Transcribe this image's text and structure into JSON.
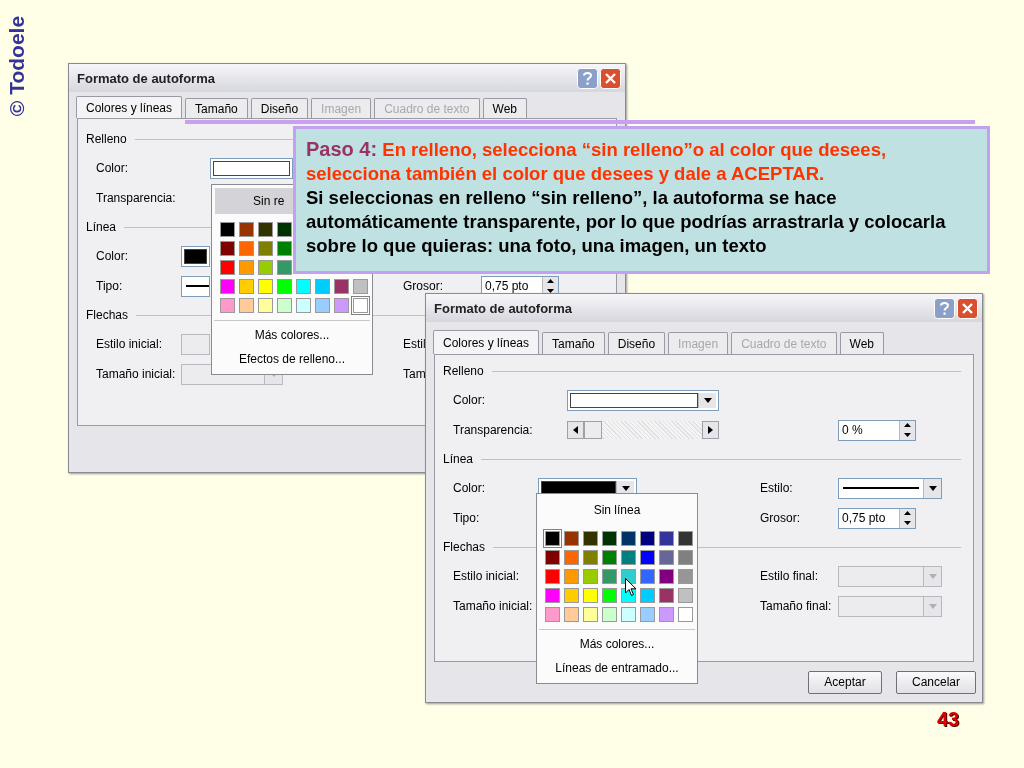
{
  "logo": "© Todoele",
  "dialogs": [
    {
      "title": "Formato de autoforma",
      "tabs": [
        {
          "label": "Colores y líneas",
          "selected": true,
          "disabled": false
        },
        {
          "label": "Tamaño",
          "selected": false,
          "disabled": false
        },
        {
          "label": "Diseño",
          "selected": false,
          "disabled": false
        },
        {
          "label": "Imagen",
          "selected": false,
          "disabled": true
        },
        {
          "label": "Cuadro de texto",
          "selected": false,
          "disabled": true
        },
        {
          "label": "Web",
          "selected": false,
          "disabled": false
        }
      ],
      "sections": [
        {
          "title": "Relleno",
          "rows": [
            {
              "label": "Color:",
              "field": {
                "kind": "color",
                "color": "#ffffff"
              }
            },
            {
              "label": "Transparencia:"
            }
          ]
        },
        {
          "title": "Línea",
          "rows": [
            {
              "label": "Color:",
              "field": {
                "kind": "color",
                "color": "#000000"
              }
            },
            {
              "label": "Tipo:",
              "field": {
                "kind": "line"
              },
              "right": {
                "label": "Grosor:",
                "field": {
                  "kind": "spinner",
                  "value": "0,75 pto"
                }
              }
            }
          ]
        },
        {
          "title": "Flechas",
          "rows": [
            {
              "label": "Estilo inicial:",
              "field": {
                "kind": "dropdown",
                "disabled": true
              },
              "right": {
                "label": "Estil"
              }
            },
            {
              "label": "Tamaño inicial:",
              "field": {
                "kind": "dropdown",
                "disabled": true
              },
              "right": {
                "label": "Tam"
              }
            }
          ]
        }
      ],
      "popup": {
        "none_option": {
          "label": "Sin re",
          "highlighted": true
        },
        "swatch_rows": [
          [
            {
              "color": "#000000",
              "selected": false
            },
            {
              "color": "#993300",
              "selected": false
            },
            {
              "color": "#333300",
              "selected": false
            },
            {
              "color": "#003300",
              "selected": false
            }
          ],
          [
            {
              "color": "#800000",
              "selected": false
            },
            {
              "color": "#ff6600",
              "selected": false
            },
            {
              "color": "#808000",
              "selected": false
            },
            {
              "color": "#008000",
              "selected": false
            }
          ],
          [
            {
              "color": "#ff0000",
              "selected": false
            },
            {
              "color": "#ff9900",
              "selected": false
            },
            {
              "color": "#99cc00",
              "selected": false
            },
            {
              "color": "#339966",
              "selected": false
            }
          ],
          [
            {
              "color": "#ff00ff",
              "selected": false
            },
            {
              "color": "#ffcc00",
              "selected": false
            },
            {
              "color": "#ffff00",
              "selected": false
            },
            {
              "color": "#00ff00",
              "selected": false
            },
            {
              "color": "#00ffff",
              "selected": false
            },
            {
              "color": "#00ccff",
              "selected": false
            },
            {
              "color": "#993366",
              "selected": false
            },
            {
              "color": "#c0c0c0",
              "selected": false
            }
          ],
          [
            {
              "color": "#ff99cc",
              "selected": false
            },
            {
              "color": "#ffcc99",
              "selected": false
            },
            {
              "color": "#ffff99",
              "selected": false
            },
            {
              "color": "#ccffcc",
              "selected": false
            },
            {
              "color": "#ccffff",
              "selected": false
            },
            {
              "color": "#99ccff",
              "selected": false
            },
            {
              "color": "#cc99ff",
              "selected": false
            },
            {
              "color": "#ffffff",
              "selected": true
            }
          ]
        ],
        "menu": [
          "Más colores...",
          "Efectos de relleno..."
        ]
      }
    },
    {
      "title": "Formato de autoforma",
      "tabs": [
        {
          "label": "Colores y líneas",
          "selected": true,
          "disabled": false
        },
        {
          "label": "Tamaño",
          "selected": false,
          "disabled": false
        },
        {
          "label": "Diseño",
          "selected": false,
          "disabled": false
        },
        {
          "label": "Imagen",
          "selected": false,
          "disabled": true
        },
        {
          "label": "Cuadro de texto",
          "selected": false,
          "disabled": true
        },
        {
          "label": "Web",
          "selected": false,
          "disabled": false
        }
      ],
      "sections": [
        {
          "title": "Relleno",
          "rows": [
            {
              "label": "Color:",
              "field": {
                "kind": "color",
                "color": "#ffffff"
              }
            },
            {
              "label": "Transparencia:",
              "field": {
                "kind": "slider",
                "level": 0
              },
              "right": {
                "field": {
                  "kind": "spinner",
                  "value": "0 %"
                }
              }
            }
          ]
        },
        {
          "title": "Línea",
          "rows": [
            {
              "label": "Color:",
              "field": {
                "kind": "color",
                "color": "#000000"
              },
              "right": {
                "label": "Estilo:",
                "field": {
                  "kind": "line"
                }
              }
            },
            {
              "label": "Tipo:",
              "right": {
                "label": "Grosor:",
                "field": {
                  "kind": "spinner",
                  "value": "0,75 pto"
                }
              }
            }
          ]
        },
        {
          "title": "Flechas",
          "rows": [
            {
              "label": "Estilo inicial:",
              "right": {
                "label": "Estilo final:",
                "field": {
                  "kind": "dropdown",
                  "disabled": true
                }
              }
            },
            {
              "label": "Tamaño inicial:",
              "right": {
                "label": "Tamaño final:",
                "field": {
                  "kind": "dropdown",
                  "disabled": true
                }
              }
            }
          ]
        }
      ],
      "popup": {
        "none_option": {
          "label": "Sin línea",
          "highlighted": false
        },
        "cursor": true,
        "swatch_rows": [
          [
            {
              "color": "#000000",
              "selected": true
            },
            {
              "color": "#993300",
              "selected": false
            },
            {
              "color": "#333300",
              "selected": false
            },
            {
              "color": "#003300",
              "selected": false
            },
            {
              "color": "#003366",
              "selected": false
            },
            {
              "color": "#000080",
              "selected": false
            },
            {
              "color": "#333399",
              "selected": false
            },
            {
              "color": "#333333",
              "selected": false
            }
          ],
          [
            {
              "color": "#800000",
              "selected": false
            },
            {
              "color": "#ff6600",
              "selected": false
            },
            {
              "color": "#808000",
              "selected": false
            },
            {
              "color": "#008000",
              "selected": false
            },
            {
              "color": "#008080",
              "selected": false
            },
            {
              "color": "#0000ff",
              "selected": false
            },
            {
              "color": "#666699",
              "selected": false
            },
            {
              "color": "#808080",
              "selected": false
            }
          ],
          [
            {
              "color": "#ff0000",
              "selected": false
            },
            {
              "color": "#ff9900",
              "selected": false
            },
            {
              "color": "#99cc00",
              "selected": false
            },
            {
              "color": "#339966",
              "selected": false
            },
            {
              "color": "#33cccc",
              "selected": false
            },
            {
              "color": "#3366ff",
              "selected": false
            },
            {
              "color": "#800080",
              "selected": false
            },
            {
              "color": "#969696",
              "selected": false
            }
          ],
          [
            {
              "color": "#ff00ff",
              "selected": false
            },
            {
              "color": "#ffcc00",
              "selected": false
            },
            {
              "color": "#ffff00",
              "selected": false
            },
            {
              "color": "#00ff00",
              "selected": false
            },
            {
              "color": "#00ffff",
              "selected": false
            },
            {
              "color": "#00ccff",
              "selected": false
            },
            {
              "color": "#993366",
              "selected": false
            },
            {
              "color": "#c0c0c0",
              "selected": false
            }
          ],
          [
            {
              "color": "#ff99cc",
              "selected": false
            },
            {
              "color": "#ffcc99",
              "selected": false
            },
            {
              "color": "#ffff99",
              "selected": false
            },
            {
              "color": "#ccffcc",
              "selected": false
            },
            {
              "color": "#ccffff",
              "selected": false
            },
            {
              "color": "#99ccff",
              "selected": false
            },
            {
              "color": "#cc99ff",
              "selected": false
            },
            {
              "color": "#ffffff",
              "selected": false
            }
          ]
        ],
        "menu": [
          "Más colores...",
          "Líneas de entramado..."
        ]
      },
      "buttons": [
        "Aceptar",
        "Cancelar"
      ]
    }
  ],
  "callout": {
    "heading": "Paso 4:",
    "instruction": "En relleno, selecciona “sin relleno”o al color que desees, selecciona también el color que desees y dale a ACEPTAR.",
    "note": "Si seleccionas en relleno “sin relleno”, la autoforma se hace automáticamente transparente, por lo que podrías arrastrarla y colocarla sobre lo que quieras: una foto, una imagen, un texto"
  },
  "page_number": "43"
}
